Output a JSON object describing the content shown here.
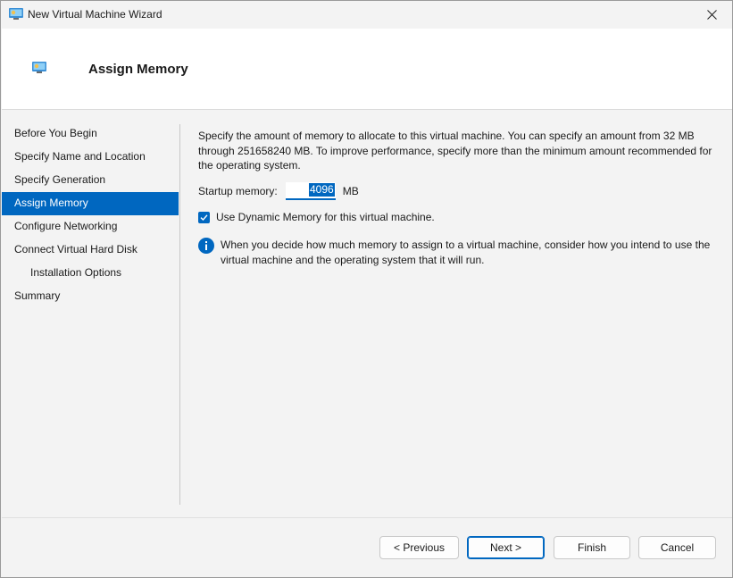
{
  "window": {
    "title": "New Virtual Machine Wizard",
    "accent_color": "#0067c0"
  },
  "header": {
    "title": "Assign Memory"
  },
  "nav": {
    "items": [
      {
        "label": "Before You Begin",
        "active": false
      },
      {
        "label": "Specify Name and Location",
        "active": false
      },
      {
        "label": "Specify Generation",
        "active": false
      },
      {
        "label": "Assign Memory",
        "active": true
      },
      {
        "label": "Configure Networking",
        "active": false
      },
      {
        "label": "Connect Virtual Hard Disk",
        "active": false
      },
      {
        "label": "Installation Options",
        "active": false
      },
      {
        "label": "Summary",
        "active": false
      }
    ]
  },
  "content": {
    "description": "Specify the amount of memory to allocate to this virtual machine. You can specify an amount from 32 MB through 251658240 MB. To improve performance, specify more than the minimum amount recommended for the operating system.",
    "startup_memory_label": "Startup memory:",
    "startup_memory_value": "4096",
    "startup_memory_unit": "MB",
    "dynamic_memory_label": "Use Dynamic Memory for this virtual machine.",
    "dynamic_memory_checked": true,
    "info_text": "When you decide how much memory to assign to a virtual machine, consider how you intend to use the virtual machine and the operating system that it will run."
  },
  "buttons": {
    "previous": "< Previous",
    "next": "Next >",
    "finish": "Finish",
    "cancel": "Cancel"
  },
  "icons": {
    "app": "virtual-machine-icon",
    "close": "close-icon",
    "checkbox": "check-icon",
    "info": "info-icon"
  }
}
